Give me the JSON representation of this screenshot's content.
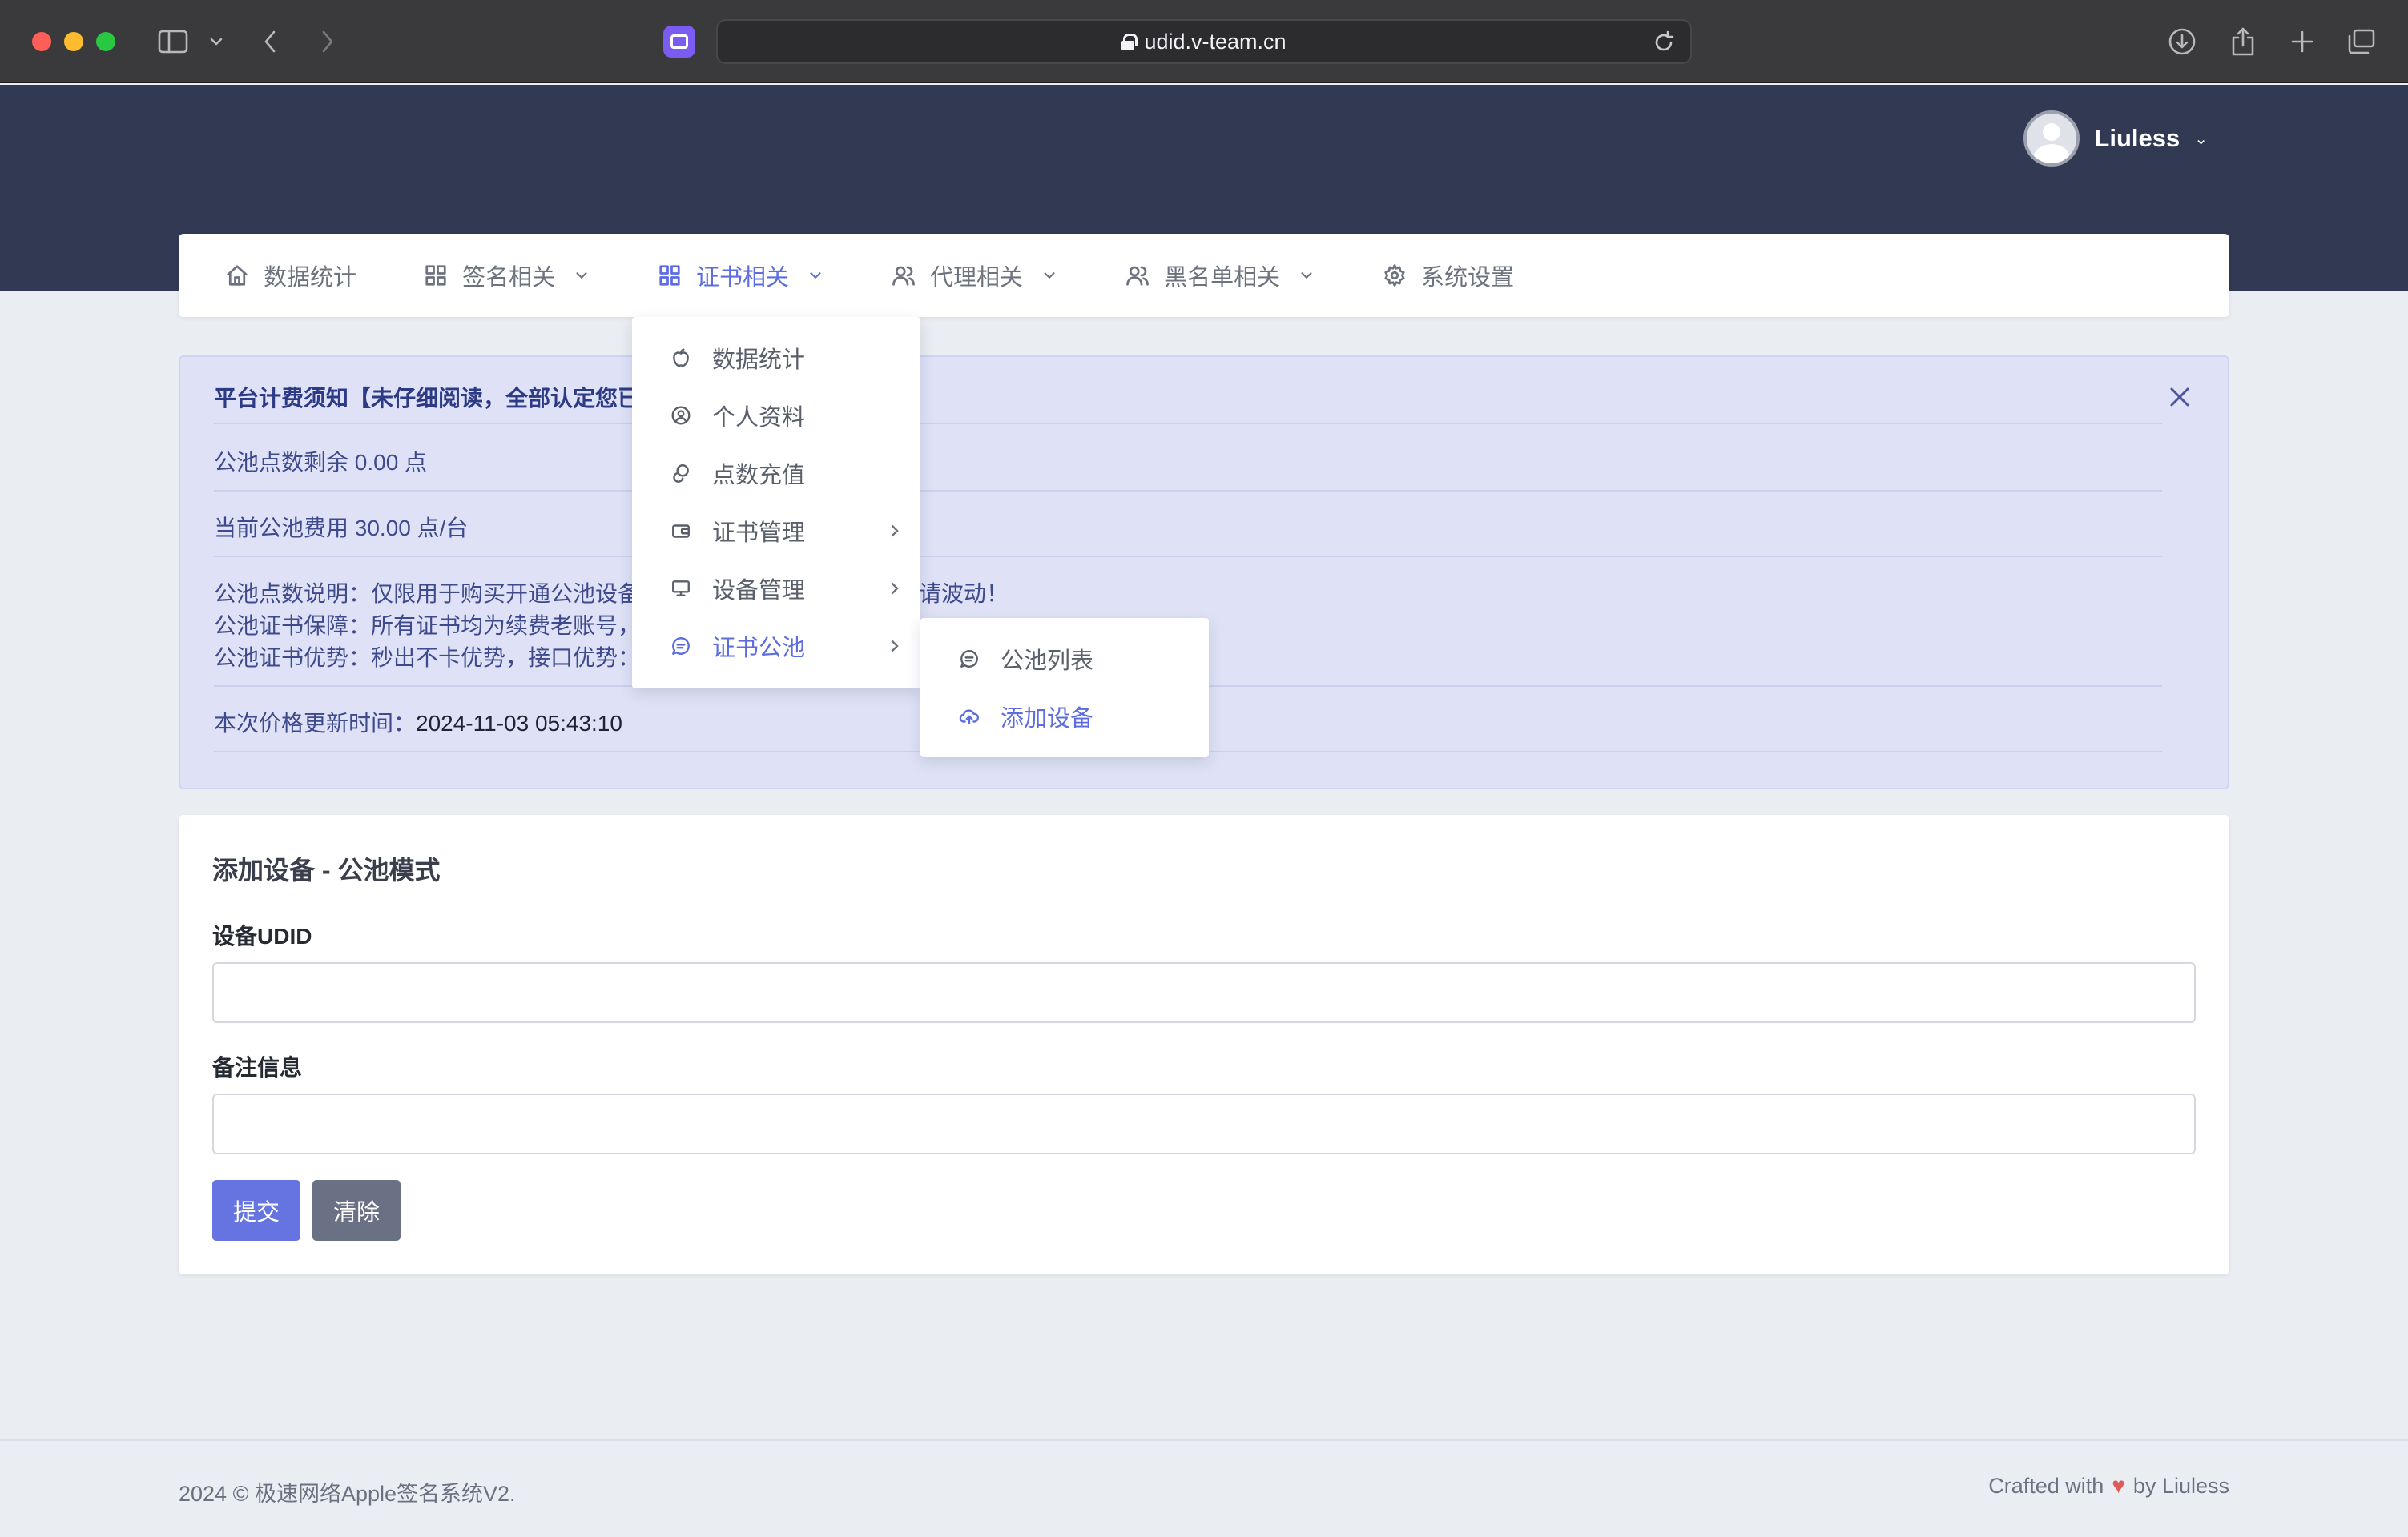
{
  "browser": {
    "url": "udid.v-team.cn"
  },
  "header": {
    "username": "Liuless"
  },
  "nav": {
    "items": [
      {
        "label": "数据统计",
        "icon": "home-icon"
      },
      {
        "label": "签名相关",
        "icon": "grid-icon"
      },
      {
        "label": "证书相关",
        "icon": "grid-icon",
        "active": true
      },
      {
        "label": "代理相关",
        "icon": "users-icon"
      },
      {
        "label": "黑名单相关",
        "icon": "users-icon"
      },
      {
        "label": "系统设置",
        "icon": "gear-icon"
      }
    ]
  },
  "dropdown": {
    "items": [
      {
        "label": "数据统计",
        "icon": "apple-icon"
      },
      {
        "label": "个人资料",
        "icon": "user-circle-icon"
      },
      {
        "label": "点数充值",
        "icon": "coins-icon"
      },
      {
        "label": "证书管理",
        "icon": "wallet-icon"
      },
      {
        "label": "设备管理",
        "icon": "monitor-icon"
      },
      {
        "label": "证书公池",
        "icon": "chat-icon"
      }
    ]
  },
  "submenu": {
    "items": [
      {
        "label": "公池列表",
        "icon": "chat-icon"
      },
      {
        "label": "添加设备",
        "icon": "upload-cloud-icon"
      }
    ]
  },
  "alert": {
    "title": "平台计费须知【未仔细阅读，全部认定您已",
    "balance": "公池点数剩余 0.00 点",
    "fee": "当前公池费用 30.00 点/台",
    "desc1": "公池点数说明：仅限用于购买开通公池设备",
    "desc1_tail": "请波动！",
    "desc2": "公池证书保障：所有证书均为续费老账号，",
    "desc3": "公池证书优势：秒出不卡优势，接口优势：",
    "update_label": "本次价格更新时间：",
    "update_time": "2024-11-03 05:43:10"
  },
  "form": {
    "title": "添加设备 - 公池模式",
    "udid_label": "设备UDID",
    "udid_value": "",
    "note_label": "备注信息",
    "note_value": "",
    "submit_label": "提交",
    "clear_label": "清除"
  },
  "footer": {
    "copyright": "2024 © 极速网络Apple签名系统V2.",
    "crafted_prefix": "Crafted with",
    "crafted_suffix": "by Liuless"
  },
  "colors": {
    "accent": "#5d6de0",
    "header_bg": "#313a52",
    "alert_bg": "#dfe2f6",
    "heart": "#e05a5a"
  }
}
